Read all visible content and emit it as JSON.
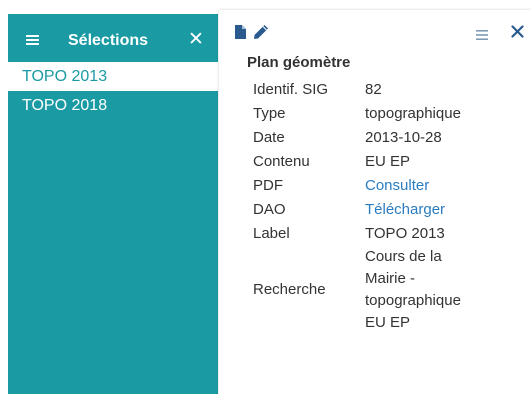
{
  "selections": {
    "title": "Sélections",
    "close_glyph": "✕",
    "items": [
      {
        "label": "TOPO 2013",
        "active": true
      },
      {
        "label": "TOPO 2018",
        "active": false
      }
    ]
  },
  "info": {
    "title": "Plan géomètre",
    "attributes": [
      {
        "key": "Identif. SIG",
        "value": "82"
      },
      {
        "key": "Type",
        "value": "topographique"
      },
      {
        "key": "Date",
        "value": "2013-10-28"
      },
      {
        "key": "Contenu",
        "value": "EU EP"
      },
      {
        "key": "PDF",
        "value": "Consulter",
        "link": true
      },
      {
        "key": "DAO",
        "value": "Télécharger",
        "link": true
      },
      {
        "key": "Label",
        "value": "TOPO 2013"
      },
      {
        "key": "Recherche",
        "value_lines": [
          "Cours de la",
          "Mairie -",
          "topographique",
          "EU EP"
        ]
      }
    ]
  },
  "icons": {
    "sidebar_menu": "list-icon",
    "sidebar_close": "close-icon",
    "toolbar_left": [
      "file-icon",
      "pencil-icon"
    ],
    "toolbar_right": [
      "list-icon",
      "close-icon"
    ]
  },
  "colors": {
    "teal": "#1a9aa3",
    "link": "#2a7cc1",
    "text": "#333333",
    "icon_blue": "#2a5a8e",
    "icon_muted": "#7f9bb8"
  }
}
